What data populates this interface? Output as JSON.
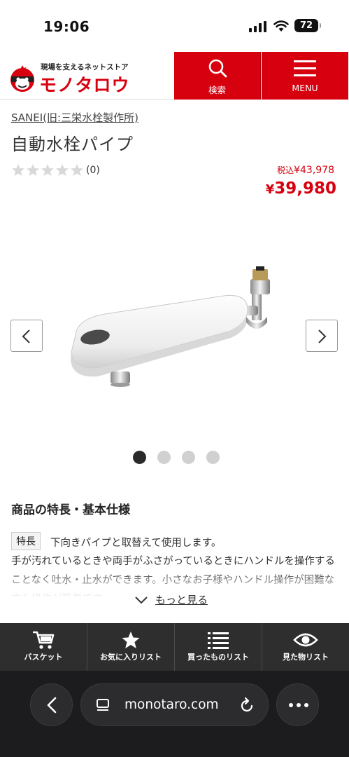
{
  "status_bar": {
    "time": "19:06",
    "battery": "72"
  },
  "header": {
    "logo_tagline": "現場を支えるネットストア",
    "logo_text": "モノタロウ",
    "search_label": "検索",
    "menu_label": "MENU",
    "accent_color": "#d7000f"
  },
  "product": {
    "brand": "SANEI(旧:三栄水栓製作所)",
    "title": "自動水栓パイプ",
    "rating_stars": 0,
    "rating_max": 5,
    "review_count": "(0)",
    "price_tax_prefix": "税込",
    "price_tax_value": "¥43,978",
    "price_currency": "¥",
    "price_value": "39,980"
  },
  "carousel": {
    "total": 4,
    "active_index": 0
  },
  "features": {
    "section_title": "商品の特長・基本仕様",
    "tag": "特長",
    "lead": "下向きパイプと取替えて使用します。",
    "body": "手が汚れているときや両手がふさがっているときにハンドルを操作することなく吐水・止水ができます。小さなお子様やハンドル操作が困難な方も操作が簡単です。",
    "more_label": "もっと見る"
  },
  "app_nav": [
    {
      "icon": "cart-icon",
      "label": "バスケット"
    },
    {
      "icon": "star-icon",
      "label": "お気に入りリスト"
    },
    {
      "icon": "list-icon",
      "label": "買ったものリスト"
    },
    {
      "icon": "eye-icon",
      "label": "見た物リスト"
    }
  ],
  "browser": {
    "url": "monotaro.com"
  }
}
